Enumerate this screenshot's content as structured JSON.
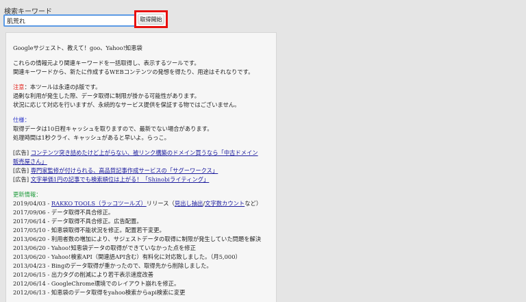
{
  "search": {
    "label": "検索キーワード",
    "value": "肌荒れ",
    "button_label": "取得開始"
  },
  "intro": {
    "title": "Googleサジェスト、教えて！goo、Yahoo!知恵袋",
    "line1": "これらの情報元より関連キーワードを一括取得し、表示するツールです。",
    "line2": "関連キーワードから、新たに作成するWEBコンテンツの発想を得たり、用途はそれなりです。"
  },
  "notice": {
    "label": "注意",
    "line1_rest": "：本ツールは永遠のβ版です。",
    "line2": "過剰な利用が発生した際、データ取得に制限が掛かる可能性があります。",
    "line3": "状況に応じて対応を行いますが、永続的なサービス提供を保証する物ではございません。"
  },
  "spec": {
    "label": "仕様",
    "label_suffix": "：",
    "line1": "取得データは10日程キャッシュを取りますので、最新でない場合があります。",
    "line2": "処理時間は1秒クライ、キャッシュがあると早いよ。らっこ。"
  },
  "ads": [
    {
      "prefix": "[広告]",
      "text": "コンテンツ突き詰めたけど上がらない、被リンク構築のドメイン買うなら「中古ドメイン",
      "text2": "販売屋さん」"
    },
    {
      "prefix": "[広告]",
      "text": "専門家監修が付けられる、高品質記事作成サービスの「サグーワークス」"
    },
    {
      "prefix": "[広告]",
      "text": "文字単価1円の記事でも検索順位は上がる！「Shinobiライティング」"
    }
  ],
  "updates": {
    "label": "更新情報",
    "label_suffix": "：",
    "first": {
      "date": "2019/04/03 - ",
      "link": "RAKKO TOOLS（ラッコツールズ）",
      "mid": "リリース（",
      "link2": "見出し抽出",
      "sep": "/",
      "link3": "文字数カウント",
      "end": "など）"
    },
    "items": [
      "2017/09/06 - データ取得不具合修正。",
      "2017/06/14 - データ取得不具合修正。広告配置。",
      "2017/05/10 - 知恵袋取得不能状況を修正。配置若干変更。",
      "2013/06/20 - 利用者数の増加により、サジェストデータの取得に制限が発生していた問題を解決",
      "2013/06/20 - Yahoo!知恵袋データの取得ができていなかった点を修正",
      "2013/06/20 - Yahoo!検索API（関連語API含む）有料化に対応致しました。（月5,000）",
      "2013/04/23 - Bingのデータ取得が重かったので、取得先から削除しました。",
      "2012/06/15 - 出力タグの削減により若干表示速度改善",
      "2012/06/14 - GoogleChrome環境でのレイアウト崩れを修正。",
      "2012/06/13 - 知恵袋のデータ取得をyahoo検索からapi検索に変更"
    ]
  }
}
